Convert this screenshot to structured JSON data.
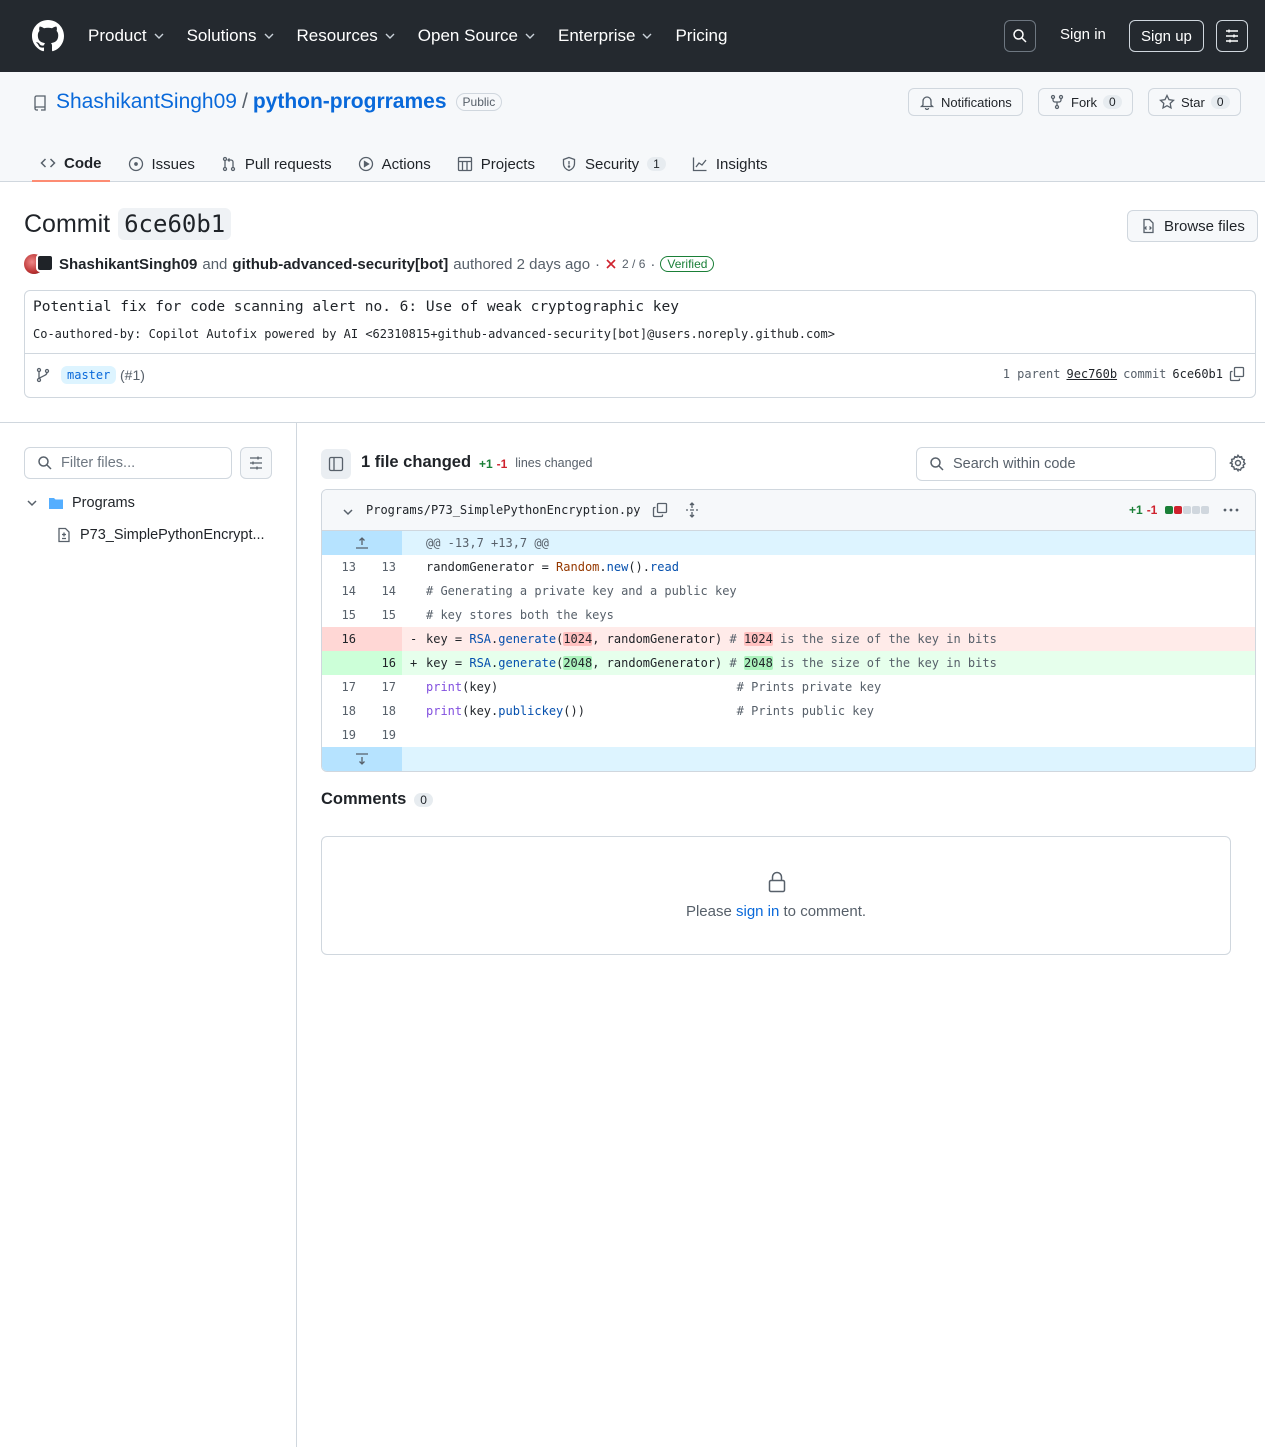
{
  "nav": {
    "items": [
      "Product",
      "Solutions",
      "Resources",
      "Open Source",
      "Enterprise",
      "Pricing"
    ],
    "sign_in": "Sign in",
    "sign_up": "Sign up"
  },
  "repo": {
    "owner": "ShashikantSingh09",
    "separator": "/",
    "name": "python-progrrames",
    "visibility": "Public",
    "notifications_label": "Notifications",
    "fork_label": "Fork",
    "fork_count": "0",
    "star_label": "Star",
    "star_count": "0",
    "tabs": [
      {
        "label": "Code",
        "icon": "code-icon"
      },
      {
        "label": "Issues",
        "icon": "issue-icon"
      },
      {
        "label": "Pull requests",
        "icon": "pull-request-icon"
      },
      {
        "label": "Actions",
        "icon": "play-icon"
      },
      {
        "label": "Projects",
        "icon": "table-icon"
      },
      {
        "label": "Security",
        "icon": "shield-icon",
        "count": "1"
      },
      {
        "label": "Insights",
        "icon": "graph-icon"
      }
    ]
  },
  "commit": {
    "title_prefix": "Commit",
    "sha": "6ce60b1",
    "browse_files": "Browse files",
    "author1": "ShashikantSingh09",
    "and": "and",
    "author2": "github-advanced-security[bot]",
    "authored": "authored 2 days ago",
    "dot": "·",
    "checks": "2 / 6",
    "verified": "Verified",
    "message_title": "Potential fix for code scanning alert no. 6: Use of weak cryptographic key",
    "message_body": "Co-authored-by: Copilot Autofix powered by AI <62310815+github-advanced-security[bot]@users.noreply.github.com>",
    "branch": "master",
    "pr": "(#1)",
    "parent_label": "1 parent",
    "parent_sha": "9ec760b",
    "commit_label": "commit",
    "commit_sha": "6ce60b1"
  },
  "sidebar": {
    "filter_placeholder": "Filter files...",
    "folder": "Programs",
    "file": "P73_SimplePythonEncrypt..."
  },
  "diff": {
    "files_changed": "1 file changed",
    "additions": "+1",
    "deletions": "-1",
    "lines_changed": "lines changed",
    "search_placeholder": "Search within code",
    "file_path": "Programs/P73_SimplePythonEncryption.py",
    "file_additions": "+1",
    "file_deletions": "-1",
    "hunk_header": "@@ -13,7 +13,7 @@",
    "rows": [
      {
        "old": "13",
        "new": "13",
        "code": "randomGenerator = Random.new().read"
      },
      {
        "old": "14",
        "new": "14",
        "code": "# Generating a private key and a public key"
      },
      {
        "old": "15",
        "new": "15",
        "code": "# key stores both the keys"
      },
      {
        "old": "16",
        "new": "",
        "sign": "-",
        "code": "key = RSA.generate(1024, randomGenerator) # 1024 is the size of the key in bits"
      },
      {
        "old": "",
        "new": "16",
        "sign": "+",
        "code": "key = RSA.generate(2048, randomGenerator) # 2048 is the size of the key in bits"
      },
      {
        "old": "17",
        "new": "17",
        "code": "print(key)                                 # Prints private key"
      },
      {
        "old": "18",
        "new": "18",
        "code": "print(key.publickey())                     # Prints public key"
      },
      {
        "old": "19",
        "new": "19",
        "code": ""
      }
    ]
  },
  "comments": {
    "title": "Comments",
    "count": "0",
    "prompt_before": "Please",
    "sign_in_link": "sign in",
    "prompt_after": "to comment."
  },
  "colors": {
    "header_bg": "#24292f",
    "link": "#0969da",
    "addition": "#1a7f37",
    "deletion": "#cf222e",
    "tab_underline": "#fd8c73"
  }
}
